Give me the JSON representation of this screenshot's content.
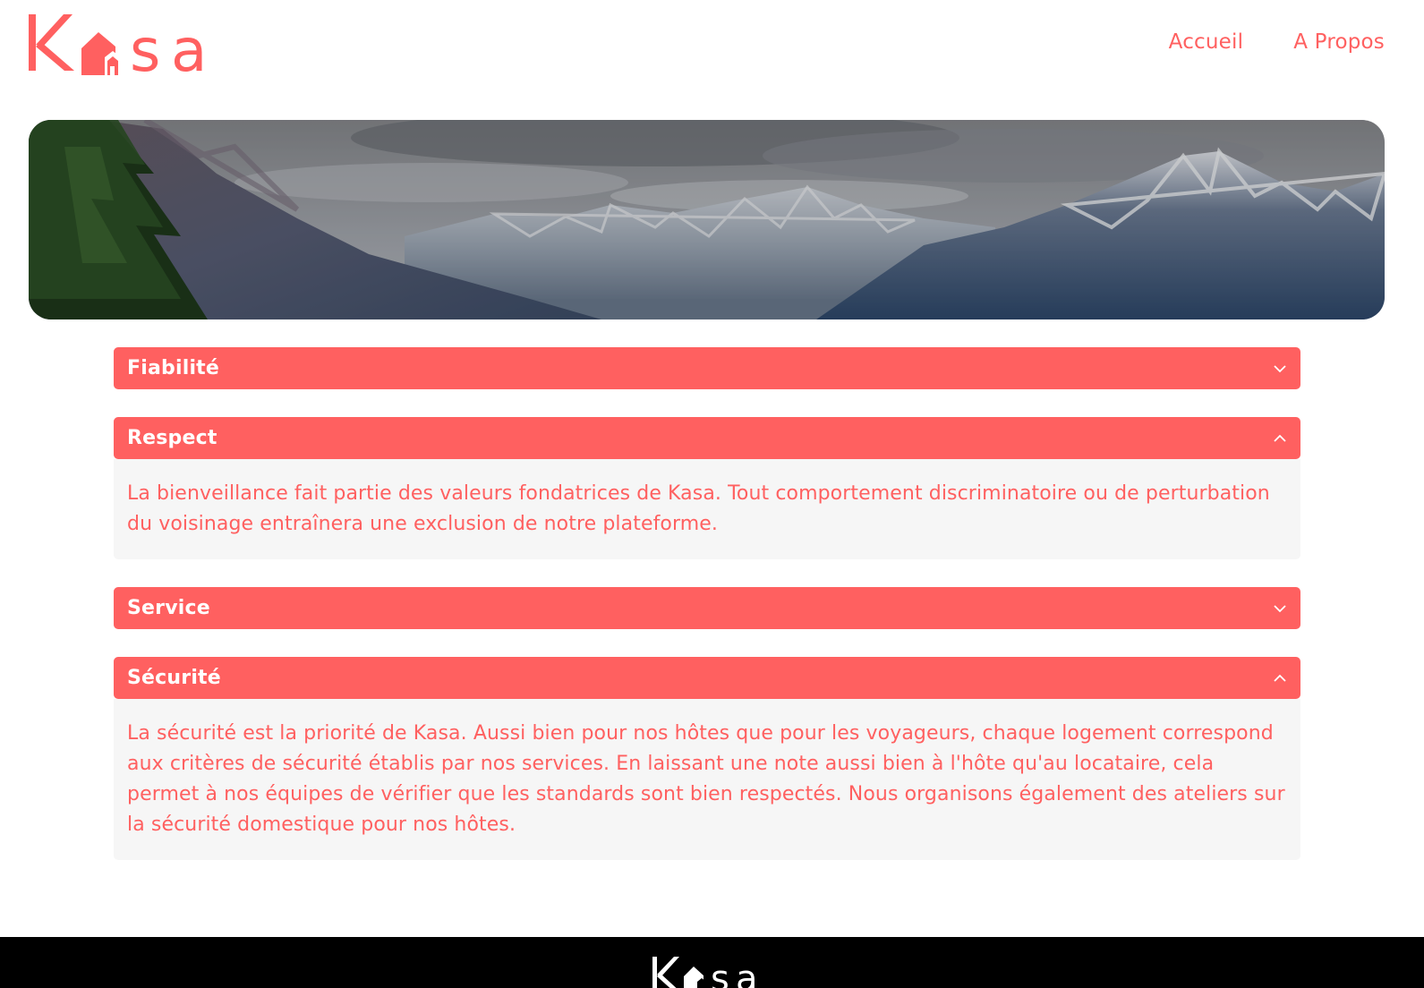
{
  "brand": {
    "name": "Kasa",
    "accent_color": "#ff6060"
  },
  "nav": {
    "items": [
      {
        "label": "Accueil"
      },
      {
        "label": "A Propos"
      }
    ]
  },
  "banner": {
    "image": "mountain-landscape"
  },
  "sections": [
    {
      "title": "Fiabilité",
      "expanded": false,
      "icon": "chevron-down-icon"
    },
    {
      "title": "Respect",
      "expanded": true,
      "icon": "chevron-up-icon",
      "content": "La bienveillance fait partie des valeurs fondatrices de Kasa. Tout comportement discriminatoire ou de perturbation du voisinage entraînera une exclusion de notre plateforme."
    },
    {
      "title": "Service",
      "expanded": false,
      "icon": "chevron-down-icon"
    },
    {
      "title": "Sécurité",
      "expanded": true,
      "icon": "chevron-up-icon",
      "content": "La sécurité est la priorité de Kasa. Aussi bien pour nos hôtes que pour les voyageurs, chaque logement correspond aux critères de sécurité établis par nos services. En laissant une note aussi bien à l'hôte qu'au locataire, cela permet à nos équipes de vérifier que les standards sont bien respectés. Nous organisons également des ateliers sur la sécurité domestique pour nos hôtes."
    }
  ],
  "footer": {
    "logo": "kasa-logo-white",
    "background": "#000000"
  }
}
